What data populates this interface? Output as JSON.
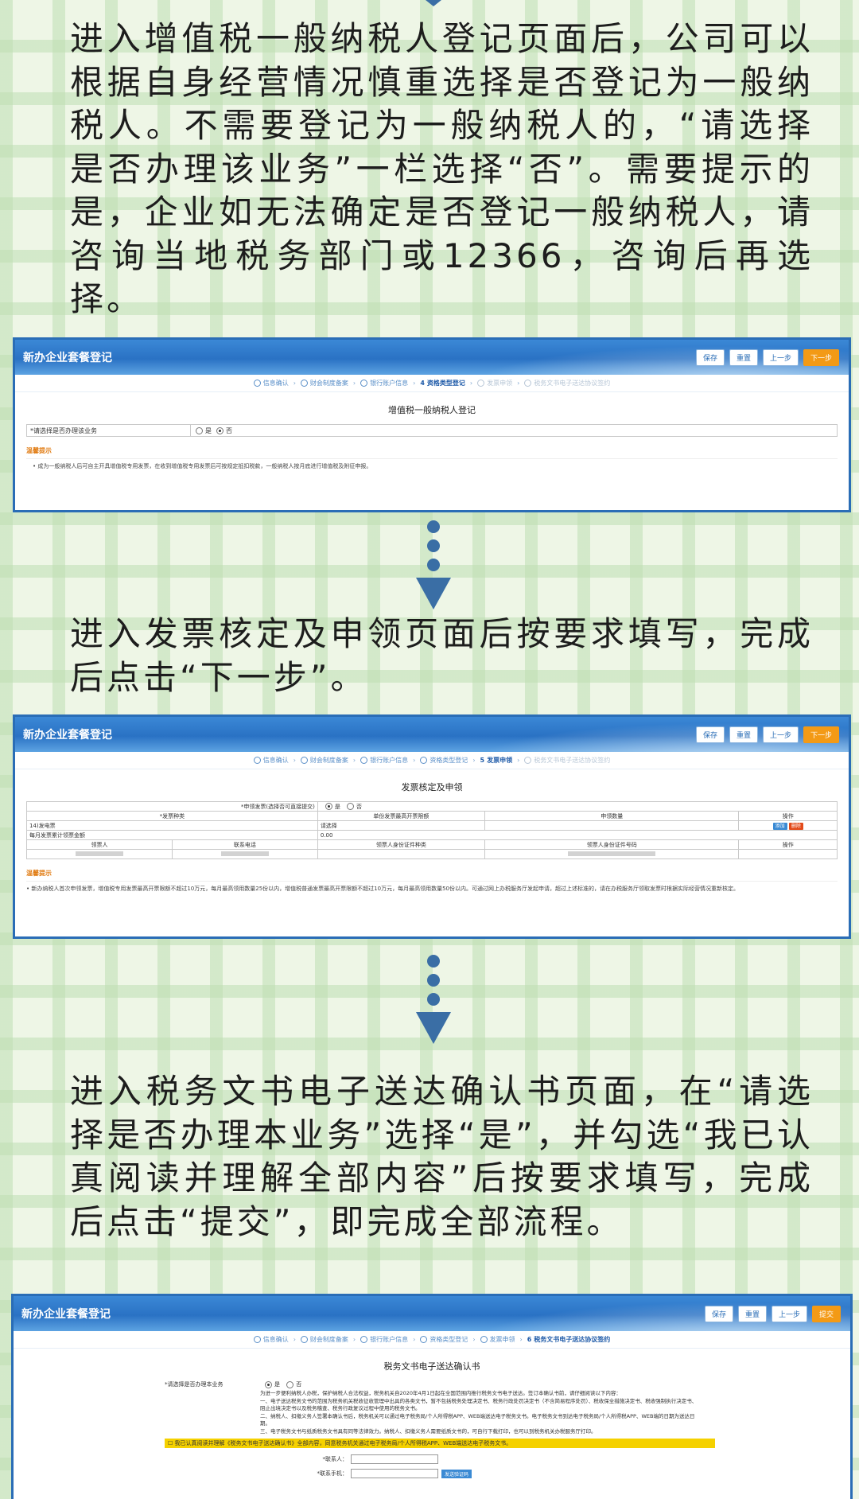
{
  "paragraphs": {
    "p1": "进入增值税一般纳税人登记页面后，公司可以根据自身经营情况慎重选择是否登记为一般纳税人。不需要登记为一般纳税人的，“请选择是否办理该业务”一栏选择“否”。需要提示的是，企业如无法确定是否登记一般纳税人，请咨询当地税务部门或12366，咨询后再选择。",
    "p2": "进入发票核定及申领页面后按要求填写，完成后点击“下一步”。",
    "p3": "进入税务文书电子送达确认书页面，在“请选择是否办理本业务”选择“是”，并勾选“我已认真阅读并理解全部内容”后按要求填写，完成后点击“提交”，即完成全部流程。"
  },
  "app_title": "新办企业套餐登记",
  "buttons": {
    "save": "保存",
    "reset": "重置",
    "prev": "上一步",
    "next": "下一步",
    "submit": "提交"
  },
  "steps": [
    "信息确认",
    "财会制度备案",
    "银行账户信息",
    "资格类型登记",
    "发票申领",
    "税务文书电子送达协议签约"
  ],
  "step_numbers": {
    "s4": "4",
    "s5": "5",
    "s6": "6"
  },
  "shot1": {
    "form_title": "增值税一般纳税人登记",
    "field_label": "*请选择是否办理该业务",
    "yes": "是",
    "no": "否",
    "tip_title": "温馨提示",
    "tip_text": "• 成为一般纳税人后可自主开具增值税专用发票，在收到增值税专用发票后可按规定抵扣税款，一般纳税人按月底进行增值税及附征申报。"
  },
  "shot2": {
    "form_title": "发票核定及申领",
    "field_label": "*申领发票(选择否可直接提交)",
    "yes": "是",
    "no": "否",
    "col_invoice_type": "*发票种类",
    "col_max": "单份发票最高开票限额",
    "col_qty": "申领数量",
    "col_op": "操作",
    "row_invoice": "14)发电票",
    "row_max_value": "请选择",
    "add": "添加",
    "delete": "删除",
    "row_monthly": "每月发票累计领票金额",
    "row_monthly_value": "0.00",
    "col_receiver": "领票人",
    "col_phone": "联系电话",
    "col_id_type": "领票人身份证件种类",
    "col_id_no": "领票人身份证件号码",
    "col_op2": "操作",
    "tip_title": "温馨提示",
    "tip_text": "• 新办纳税人首次申领发票，增值税专用发票最高开票限额不超过10万元，每月最高领用数量25份以内，增值税普通发票最高开票限额不超过10万元，每月最高领用数量50份以内。可通过网上办税服务厅发起申请，超过上述标准的，请在办税服务厅领取发票时根据实际经营情况重新核定。"
  },
  "shot3": {
    "form_title": "税务文书电子送达确认书",
    "field_label": "*请选择是否办理本业务",
    "yes": "是",
    "no": "否",
    "doc_lines": [
      "为进一步便利纳税人办税，保护纳税人合法权益，税务机关自2020年4月1日起在全国范围内推行税务文书电子送达。签订本确认书前，请仔细阅读以下内容：",
      "一、电子送达税务文书的范围为税务机关税收征收管理中出具的各类文书，暂不包括税务处理决定书、税务行政处罚决定书（不含简易程序处罚）、税收保全措施决定书、税收强制执行决定书、阻止出境决定书以及税务稽查、税务行政复议过程中使用的税务文书。",
      "二、纳税人、扣缴义务人签署本确认书后，税务机关可以通过电子税务局/个人所得税APP、WEB端送达电子税务文书。电子税务文书到达电子税务局/个人所得税APP、WEB端的日期为送达日期。",
      "三、电子税务文书与纸质税务文书具有同等法律效力。纳税人、扣缴义务人需要纸质文书的，可自行下载打印，也可以到税务机关办税服务厅打印。"
    ],
    "agree_text": "我已认真阅读并理解《税务文书电子送达确认书》全部内容，同意税务机关通过电子税务局/个人所得税APP、WEB端送达电子税务文书。",
    "contact_label": "*联系人：",
    "phone_label": "*联系手机：",
    "send_code": "发送验证码"
  }
}
